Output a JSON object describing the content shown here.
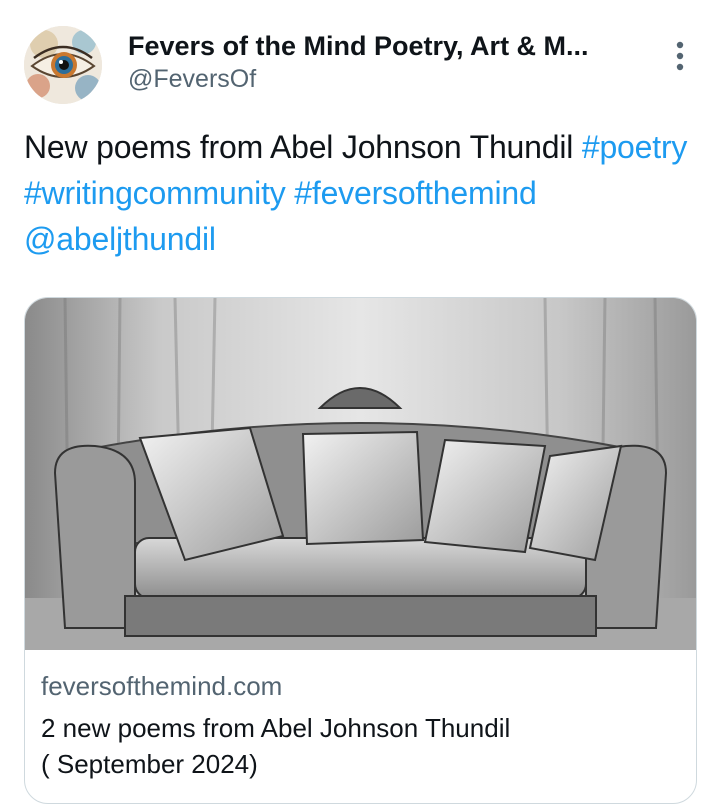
{
  "author": {
    "display_name": "Fevers of the Mind Poetry, Art & M...",
    "handle": "@FeversOf"
  },
  "tweet": {
    "text_plain": "New poems from Abel Johnson Thundil ",
    "hashtags": [
      "#poetry",
      "#writingcommunity",
      "#feversofthemind"
    ],
    "mention": "@abeljthundil"
  },
  "card": {
    "domain": "feversofthemind.com",
    "title_line1": "2 new poems from Abel Johnson Thundil",
    "title_line2": "( September 2024)"
  },
  "icons": {
    "more": "more-vertical-icon",
    "avatar": "eye-painting-avatar",
    "card_image": "sofa-sketch-image"
  },
  "colors": {
    "link": "#1d9bf0",
    "text": "#0f1419",
    "secondary": "#536471",
    "border": "#cfd9de"
  }
}
